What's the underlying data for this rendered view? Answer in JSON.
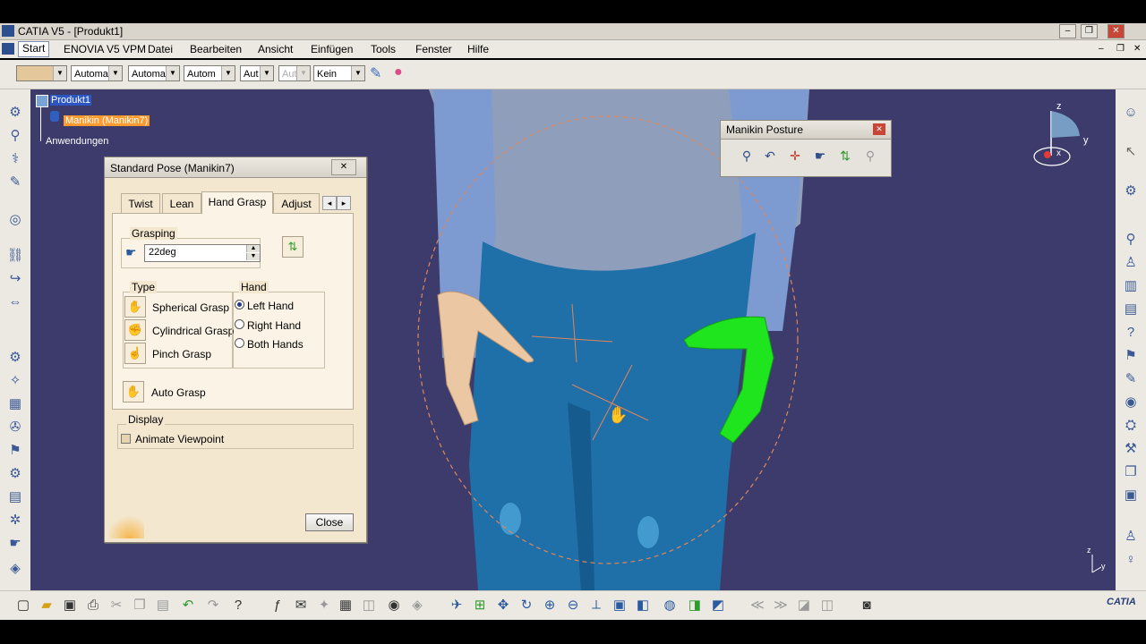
{
  "window": {
    "title": "CATIA V5 - [Produkt1]",
    "minimize": "–",
    "restore": "❐",
    "close": "✕"
  },
  "menubar": {
    "items": [
      "Start",
      "ENOVIA V5 VPM",
      "Datei",
      "Bearbeiten",
      "Ansicht",
      "Einfügen",
      "Tools",
      "Fenster",
      "Hilfe"
    ]
  },
  "properties_toolbar": {
    "fields": [
      "Automa",
      "Automa",
      "Autom",
      "Aut",
      "Aut",
      "Kein"
    ]
  },
  "tree": {
    "root": "Produkt1",
    "child": "Manikin (Manikin7)",
    "applications": "Anwendungen"
  },
  "dialog": {
    "title": "Standard Pose (Manikin7)",
    "close_x": "✕",
    "tabs": [
      "Twist",
      "Lean",
      "Hand Grasp",
      "Adjust Elb"
    ],
    "tab_prev": "◂",
    "tab_next": "▸",
    "grasping_legend": "Grasping",
    "grasping_value": "22deg",
    "type_legend": "Type",
    "type_options": [
      "Spherical Grasp",
      "Cylindrical Grasp",
      "Pinch Grasp"
    ],
    "hand_legend": "Hand",
    "hand_options": [
      "Left Hand",
      "Right Hand",
      "Both Hands"
    ],
    "hand_selected": "Left Hand",
    "auto_grasp": "Auto Grasp",
    "display_legend": "Display",
    "animate_viewpoint": "Animate Viewpoint",
    "close_button": "Close"
  },
  "posture_toolbar": {
    "title": "Manikin Posture",
    "close_x": "✕"
  },
  "compass": {
    "z": "z",
    "y": "y",
    "x": "x"
  },
  "axis_mini": {
    "z": "z",
    "y": "y"
  },
  "brand": "CATIA",
  "colors": {
    "viewport_bg": "#3c3b6c",
    "left_hand": "#1ee51e",
    "dialog_bg": "#f4e7cf",
    "tree_highlight": "#ff9a2e"
  }
}
